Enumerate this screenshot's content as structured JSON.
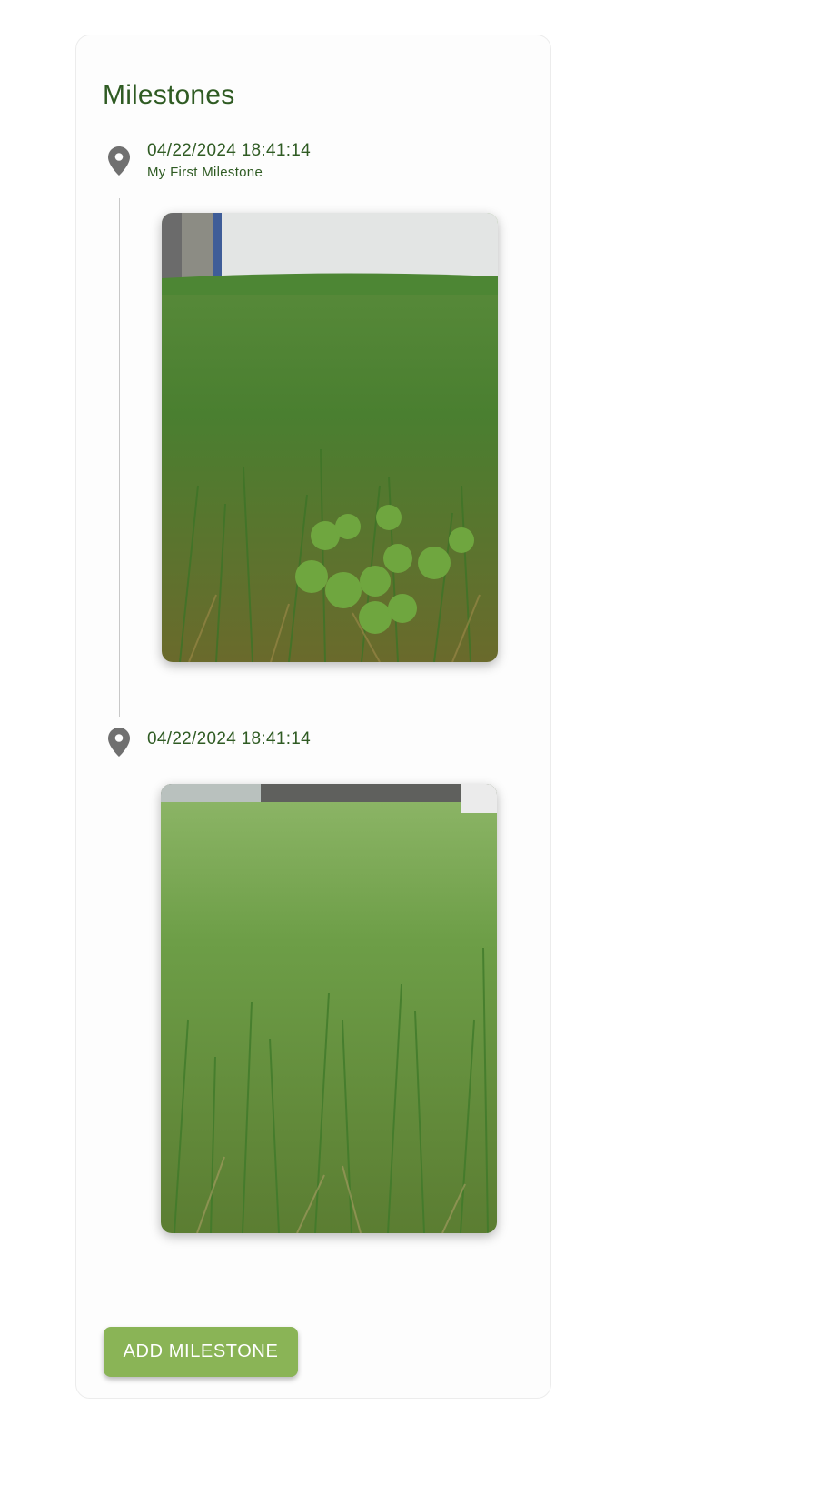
{
  "section": {
    "title": "Milestones"
  },
  "milestones": [
    {
      "timestamp": "04/22/2024 18:41:14",
      "description": "My First Milestone",
      "icon": "map-pin-icon",
      "photo": "grass-with-clover-photo"
    },
    {
      "timestamp": "04/22/2024 18:41:14",
      "description": "",
      "icon": "map-pin-icon",
      "photo": "grass-lawn-photo"
    }
  ],
  "actions": {
    "add_milestone_label": "ADD MILESTONE"
  },
  "colors": {
    "text_green": "#2f5b23",
    "button_green": "#8ab456",
    "pin_gray": "#707070",
    "timeline_line": "#c8c8c8"
  }
}
